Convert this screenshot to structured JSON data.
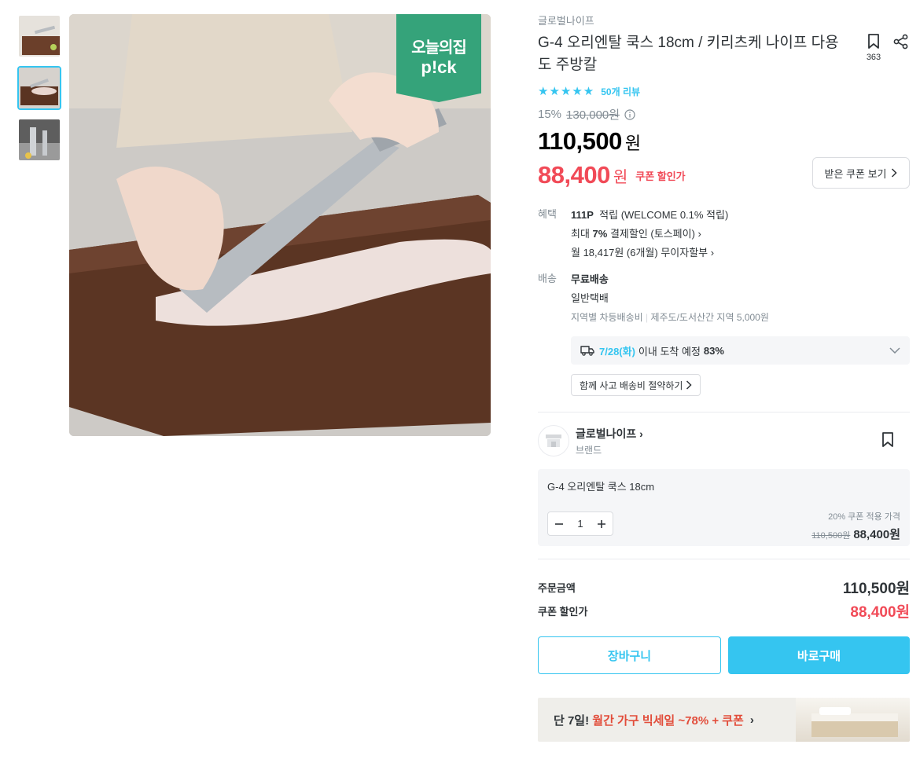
{
  "gallery": {
    "badge_line1": "오늘의집",
    "badge_line2": "p!ck"
  },
  "product": {
    "brand": "글로벌나이프",
    "title": "G-4 오리엔탈 쿡스 18cm / 키리츠케 나이프 다용도 주방칼",
    "bookmark_count": "363",
    "stars": "★★★★★",
    "reviews": "50개 리뷰",
    "discount": "15%",
    "original_price": "130,000원",
    "price": "110,500",
    "price_unit": "원",
    "coupon_price": "88,400",
    "coupon_unit": "원",
    "coupon_label": "쿠폰 할인가",
    "coupon_button": "받은 쿠폰 보기"
  },
  "benefits": {
    "key": "혜택",
    "points": "111P",
    "points_text": "적립 (WELCOME 0.1% 적립)",
    "pay_prefix": "최대",
    "pay_pct": "7%",
    "pay_text": "결제할인 (토스페이)",
    "installment": "월 18,417원 (6개월) 무이자할부"
  },
  "shipping": {
    "key": "배송",
    "type": "무료배송",
    "method": "일반택배",
    "extra_a": "지역별 차등배송비",
    "extra_b": "제주도/도서산간 지역 5,000원",
    "eta_date": "7/28(화)",
    "eta_text": "이내 도착 예정",
    "eta_pct": "83%",
    "together": "함께 사고 배송비 절약하기"
  },
  "seller": {
    "name": "글로벌나이프",
    "sub": "브랜드"
  },
  "option": {
    "name": "G-4 오리엔탈 쿡스 18cm",
    "qty": "1",
    "caption": "20% 쿠폰 적용 가격",
    "orig": "110,500원",
    "price": "88,400원"
  },
  "totals": {
    "order_label": "주문금액",
    "order_value": "110,500원",
    "coupon_label": "쿠폰 할인가",
    "coupon_value": "88,400원"
  },
  "buttons": {
    "cart": "장바구니",
    "buy": "바로구매"
  },
  "banner": {
    "prefix": "단 7일!",
    "highlight": "월간 가구 빅세일 ~78% + 쿠폰"
  },
  "colors": {
    "accent": "#35c5f0",
    "sale": "#f14a57",
    "badge": "#35a37a"
  }
}
